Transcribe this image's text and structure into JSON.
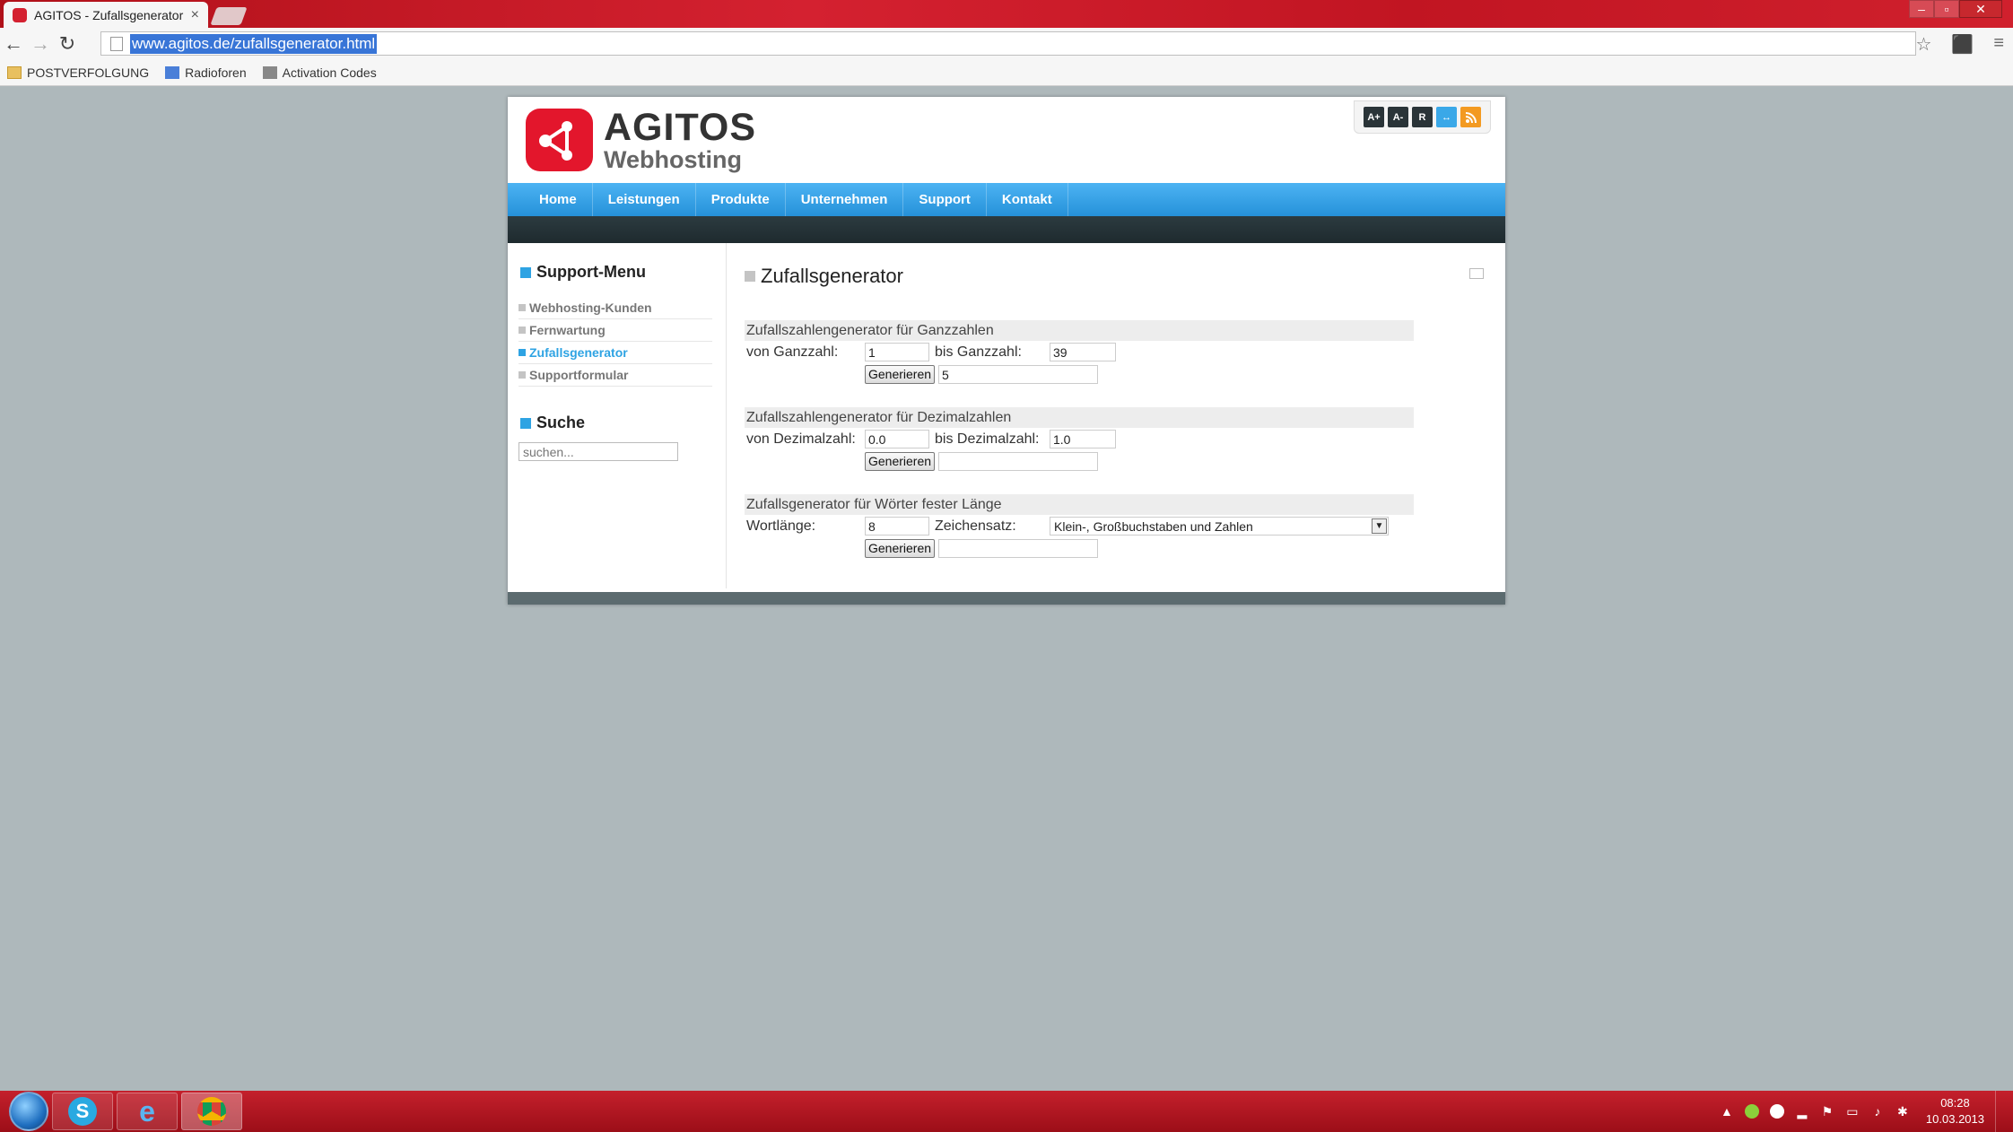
{
  "browser": {
    "tab_title": "AGITOS - Zufallsgenerator",
    "tab_close": "×",
    "url": "www.agitos.de/zufallsgenerator.html",
    "bookmarks": [
      {
        "label": "POSTVERFOLGUNG",
        "icon": "folder-icon"
      },
      {
        "label": "Radioforen",
        "icon": "google-icon"
      },
      {
        "label": "Activation Codes",
        "icon": "cart-icon"
      }
    ]
  },
  "site": {
    "brand": "AGITOS",
    "brand_sub": "Webhosting",
    "tools": [
      "A+",
      "A-",
      "R",
      "↔",
      ""
    ],
    "nav": [
      "Home",
      "Leistungen",
      "Produkte",
      "Unternehmen",
      "Support",
      "Kontakt"
    ]
  },
  "sidebar": {
    "menu_title": "Support-Menu",
    "items": [
      {
        "label": "Webhosting-Kunden",
        "active": false
      },
      {
        "label": "Fernwartung",
        "active": false
      },
      {
        "label": "Zufallsgenerator",
        "active": true
      },
      {
        "label": "Supportformular",
        "active": false
      }
    ],
    "search_title": "Suche",
    "search_placeholder": "suchen..."
  },
  "content": {
    "title": "Zufallsgenerator",
    "integer": {
      "heading": "Zufallszahlengenerator für Ganzzahlen",
      "from_label": "von Ganzzahl:",
      "from_value": "1",
      "to_label": "bis Ganzzahl:",
      "to_value": "39",
      "button": "Generieren",
      "result": "5"
    },
    "decimal": {
      "heading": "Zufallszahlengenerator für Dezimalzahlen",
      "from_label": "von Dezimalzahl:",
      "from_value": "0.0",
      "to_label": "bis Dezimalzahl:",
      "to_value": "1.0",
      "button": "Generieren",
      "result": ""
    },
    "words": {
      "heading": "Zufallsgenerator für Wörter fester Länge",
      "length_label": "Wortlänge:",
      "length_value": "8",
      "charset_label": "Zeichensatz:",
      "charset_value": "Klein-, Großbuchstaben und Zahlen",
      "button": "Generieren",
      "result": ""
    }
  },
  "taskbar": {
    "time": "08:28",
    "date": "10.03.2013"
  }
}
